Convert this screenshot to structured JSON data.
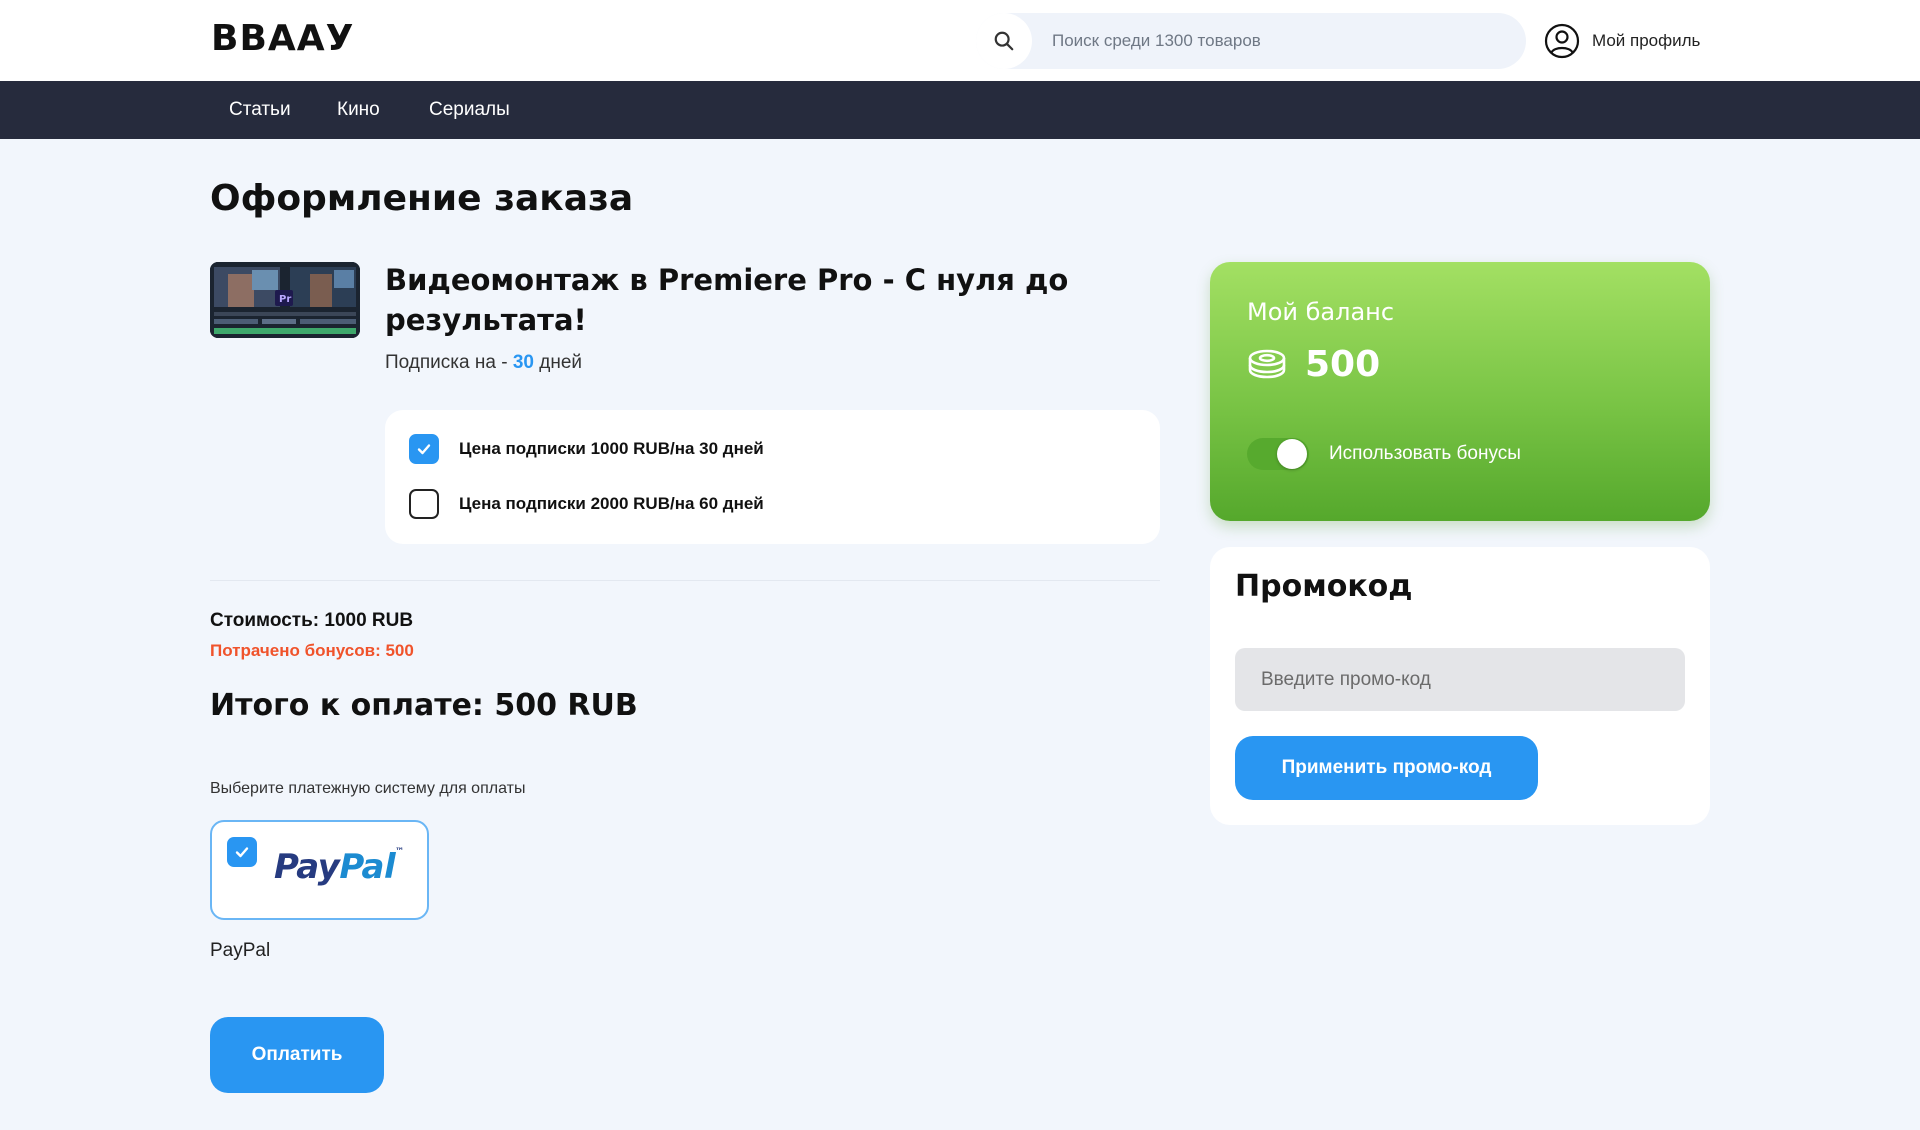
{
  "header": {
    "logo": "ВВААУ",
    "search": {
      "placeholder": "Поиск среди 1300 товаров",
      "icon": "search-icon"
    },
    "profile": {
      "label": "Мой профиль",
      "icon": "user-circle-icon"
    }
  },
  "nav": {
    "items": [
      {
        "label": "Статьи"
      },
      {
        "label": "Кино"
      },
      {
        "label": "Сериалы"
      }
    ]
  },
  "page": {
    "title": "Оформление заказа"
  },
  "product": {
    "title": "Видеомонтаж в Premiere Pro - С нуля до результата!",
    "thumbnail_badge": "Pr",
    "subscription_prefix": "Подписка на - ",
    "subscription_days": "30",
    "subscription_suffix": " дней"
  },
  "plans": [
    {
      "label": "Цена подписки 1000 RUB/на 30 дней",
      "checked": true
    },
    {
      "label": "Цена подписки 2000 RUB/на 60 дней",
      "checked": false
    }
  ],
  "summary": {
    "cost": "Стоимость: 1000 RUB",
    "bonuses_spent": "Потрачено бонусов: 500",
    "total": "Итого к оплате: 500 RUB"
  },
  "payment": {
    "hint": "Выберите платежную систему для оплаты",
    "method": {
      "logo_pay": "Pay",
      "logo_pal": "Pal",
      "logo_tm": "™",
      "name": "PayPal",
      "selected": true
    },
    "pay_button": "Оплатить"
  },
  "balance": {
    "label": "Мой баланс",
    "amount": "500",
    "icon": "coins-icon",
    "use_bonuses_label": "Использовать бонусы",
    "use_bonuses_enabled": true
  },
  "promo": {
    "title": "Промокод",
    "placeholder": "Введите промо-код",
    "apply_button": "Применить промо-код"
  },
  "colors": {
    "accent": "#2996f2",
    "nav_bg": "#262b3d",
    "page_bg": "#f2f6fc",
    "bonus_text": "#f0532b",
    "balance_green": "#79c445"
  }
}
